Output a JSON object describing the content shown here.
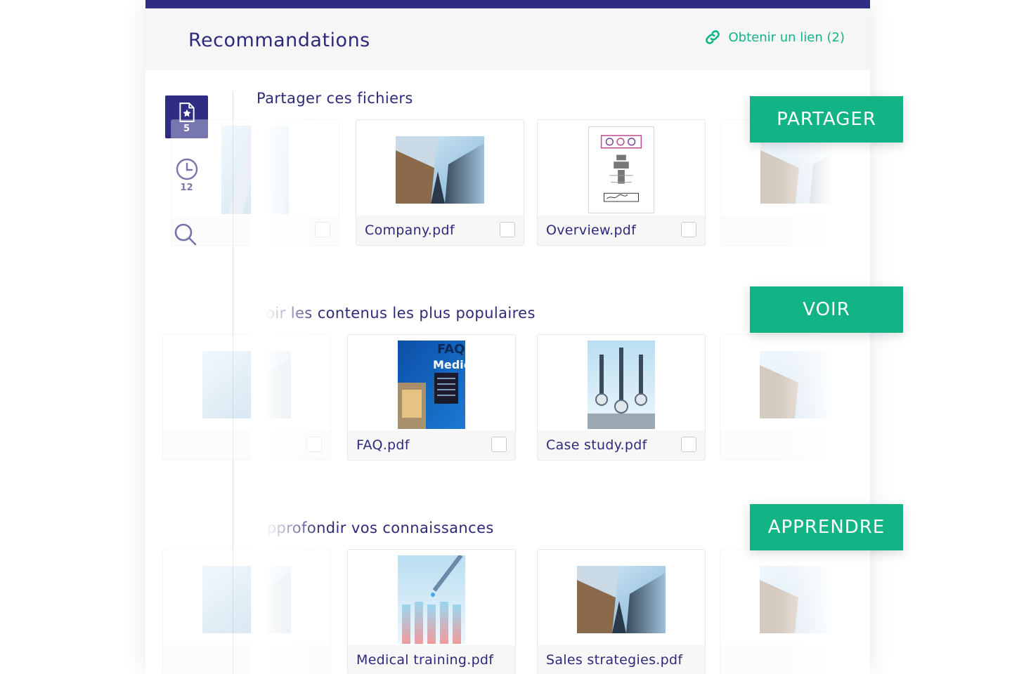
{
  "header": {
    "title": "Recommandations",
    "get_link_label": "Obtenir un lien (2)"
  },
  "sidebar": {
    "favorites_count": "5",
    "recent_count": "12"
  },
  "sections": [
    {
      "title": "Partager ces fichiers",
      "cards": [
        {
          "name": ""
        },
        {
          "name": "Company.pdf"
        },
        {
          "name": "Overview.pdf"
        },
        {
          "name": ""
        }
      ]
    },
    {
      "title": "Voir les contenus les plus populaires",
      "cards": [
        {
          "name": ""
        },
        {
          "name": "FAQ.pdf"
        },
        {
          "name": "Case study.pdf"
        },
        {
          "name": ""
        }
      ]
    },
    {
      "title": "Approfondir vos connaissances",
      "cards": [
        {
          "name": ""
        },
        {
          "name": "Medical training.pdf"
        },
        {
          "name": "Sales strategies.pdf"
        },
        {
          "name": ""
        }
      ]
    }
  ],
  "tags": {
    "share": "PARTAGER",
    "view": "VOIR",
    "learn": "APPRENDRE"
  },
  "colors": {
    "primary": "#2f2c84",
    "accent": "#12b385",
    "text": "#2e2a7a"
  }
}
